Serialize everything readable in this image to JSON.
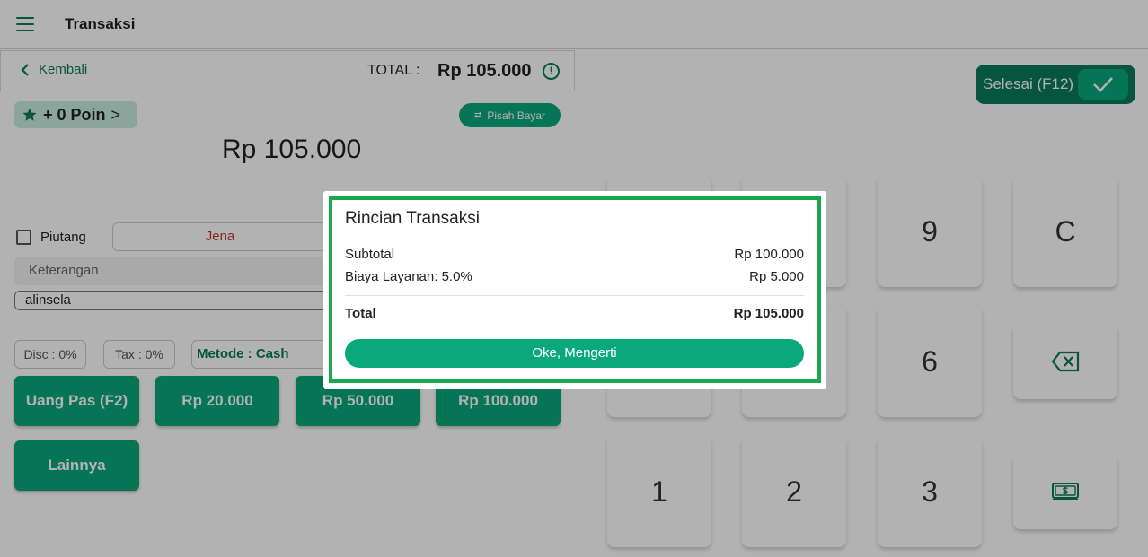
{
  "app": {
    "title": "Transaksi"
  },
  "topbar": {
    "back_label": "Kembali",
    "total_label": "TOTAL :",
    "total_value": "Rp 105.000",
    "info_glyph": "!"
  },
  "poin": {
    "label": "+ 0 Poin",
    "chevron": ">"
  },
  "pisah_bayar": {
    "label": "Pisah Bayar"
  },
  "amount": "Rp 105.000",
  "piutang": {
    "label": "Piutang",
    "checked": false
  },
  "customer": {
    "name": "Jena"
  },
  "keterangan": {
    "placeholder": "Keterangan"
  },
  "note_value": "alinsela",
  "chips": {
    "disc": "Disc : 0%",
    "tax": "Tax : 0%",
    "metode": "Metode : Cash"
  },
  "quick_buttons": [
    "Uang Pas (F2)",
    "Rp 20.000",
    "Rp 50.000",
    "Rp 100.000",
    "Lainnya"
  ],
  "selesai": {
    "label": "Selesai (F12)"
  },
  "keypad": {
    "k9": "9",
    "kC": "C",
    "k6": "6",
    "k1": "1",
    "k2": "2",
    "k3": "3"
  },
  "modal": {
    "title": "Rincian Transaksi",
    "rows": [
      {
        "label": "Subtotal",
        "value": "Rp 100.000"
      },
      {
        "label": "Biaya Layanan: 5.0%",
        "value": "Rp 5.000"
      }
    ],
    "total": {
      "label": "Total",
      "value": "Rp 105.000"
    },
    "button": "Oke, Mengerti"
  },
  "colors": {
    "primary": "#0aa87a",
    "primary_dark": "#0a7a5a",
    "highlight": "#1aa84e",
    "customer_text": "#c0392b"
  }
}
